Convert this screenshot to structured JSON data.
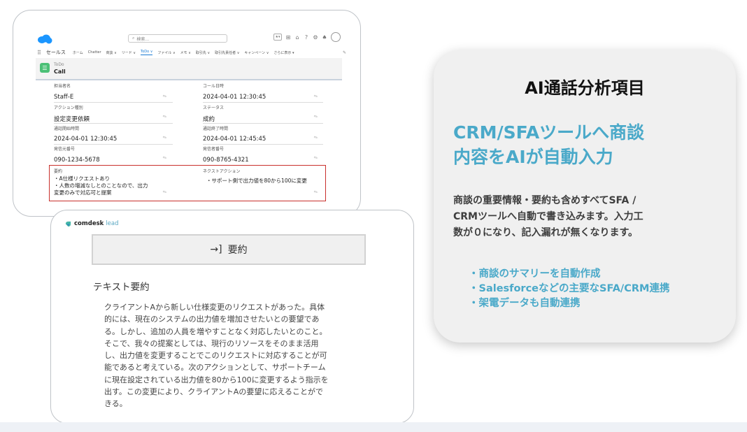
{
  "salesforce": {
    "search_placeholder": "検索...",
    "app_name": "セールス",
    "nav_items": [
      "ホーム",
      "Chatter",
      "商談 ∨",
      "リード ∨",
      "ToDo ∨",
      "ファイル ∨",
      "メモ ∨",
      "取引先 ∨",
      "取引先責任者 ∨",
      "キャンペーン ∨",
      "さらに表示 ▾"
    ],
    "active_nav": "ToDo ∨",
    "object_label": "ToDo",
    "record_title": "Call",
    "fields": {
      "assignee_label": "担当者名",
      "assignee_value": "Staff-E",
      "call_datetime_label": "コール日時",
      "call_datetime_value": "2024-04-01 12:30:45",
      "action_type_label": "アクション種別",
      "action_type_value": "設定変更依頼",
      "status_label": "ステータス",
      "status_value": "成約",
      "call_start_label": "通話開始時間",
      "call_start_value": "2024-04-01 12:30:45",
      "call_end_label": "通話終了時間",
      "call_end_value": "2024-04-01 12:45:45",
      "caller_number_label": "発信元番号",
      "caller_number_value": "090-1234-5678",
      "callee_number_label": "発信者番号",
      "callee_number_value": "090-8765-4321",
      "summary_label": "要約",
      "summary_value": "・A仕様リクエストあり\n・人数の増減なしとのことなので、出力\n変更のみで対応可と提案",
      "next_action_label": "ネクストアクション",
      "next_action_value": "・サポート側で出力値を80から100に変更"
    }
  },
  "comdesk": {
    "logo_main": "comdesk",
    "logo_sub": "lead",
    "summary_button_icon": "→]",
    "summary_button_label": "要約",
    "section_title": "テキスト要約",
    "body_text": "クライアントAから新しい仕様変更のリクエストがあった。具体\n的には、現在のシステムの出力値を増加させたいとの要望であ\nる。しかし、追加の人員を増やすことなく対応したいとのこと。\nそこで、我々の提案としては、現行のリソースをそのまま活用\nし、出力値を変更することでこのリクエストに対応することが可\n能であると考えている。次のアクションとして、サポートチーム\nに現在設定されている出力値を80から100に変更するよう指示を\n出す。この変更により、クライアントAの要望に応えることがで\nきる。"
  },
  "panel": {
    "title": "AI通話分析項目",
    "headline": "CRM/SFAツールへ商談\n内容をAIが自動入力",
    "description": "商談の重要情報・要約も含めすべてSFA /\nCRMツールへ自動で書き込みます。入力工\n数が０になり、記入漏れが無くなります。",
    "bullets": [
      "・商談のサマリーを自動作成",
      "・Salesforceなどの主要なSFA/CRM連携",
      "・架電データも自動連携"
    ]
  },
  "colors": {
    "accent": "#4aa9c9",
    "highlight_border": "#c9302c",
    "salesforce_blue": "#1b7bd3",
    "todo_green": "#4bc076"
  }
}
